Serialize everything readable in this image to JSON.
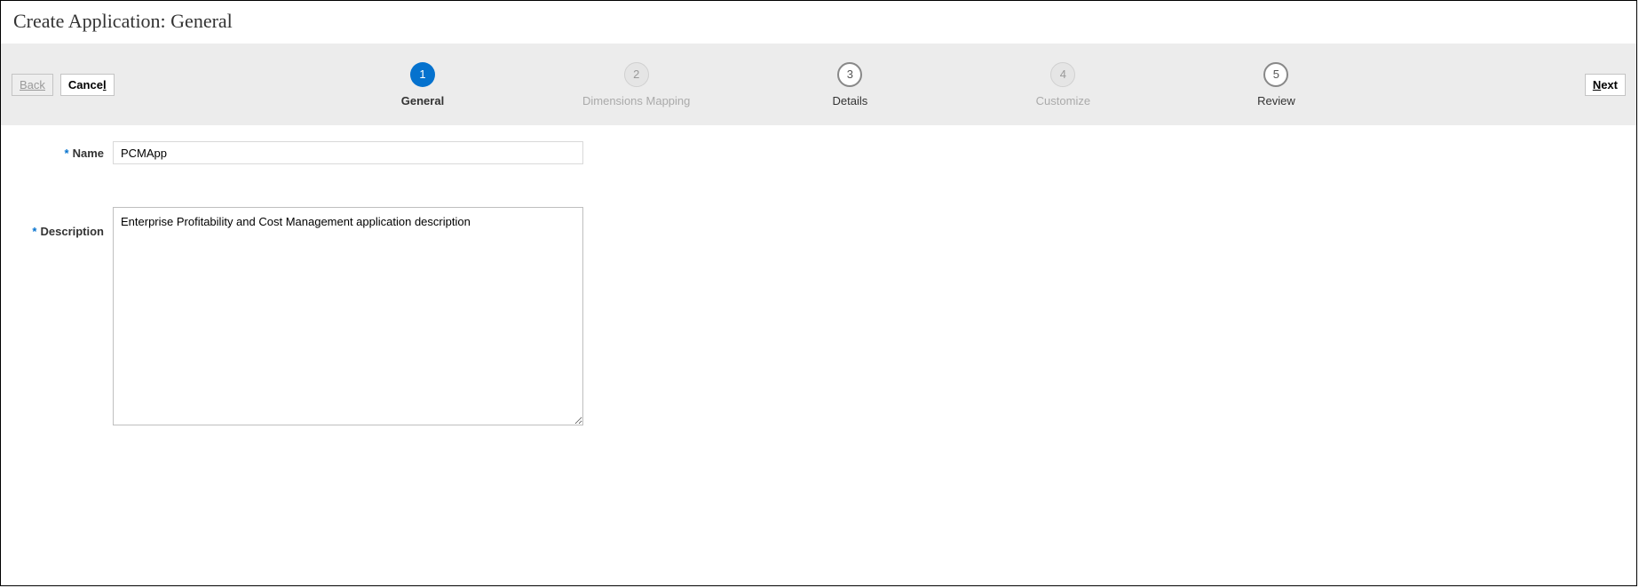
{
  "page_title": "Create Application: General",
  "nav": {
    "back_label": "Back",
    "cancel_label": "Cancel",
    "next_label": "Next"
  },
  "wizard": {
    "steps": [
      {
        "num": "1",
        "label": "General",
        "state": "active"
      },
      {
        "num": "2",
        "label": "Dimensions Mapping",
        "state": "disabled"
      },
      {
        "num": "3",
        "label": "Details",
        "state": "upcoming"
      },
      {
        "num": "4",
        "label": "Customize",
        "state": "disabled"
      },
      {
        "num": "5",
        "label": "Review",
        "state": "upcoming"
      }
    ]
  },
  "form": {
    "name_label": "Name",
    "name_value": "PCMApp",
    "description_label": "Description",
    "description_value": "Enterprise Profitability and Cost Management application description"
  }
}
